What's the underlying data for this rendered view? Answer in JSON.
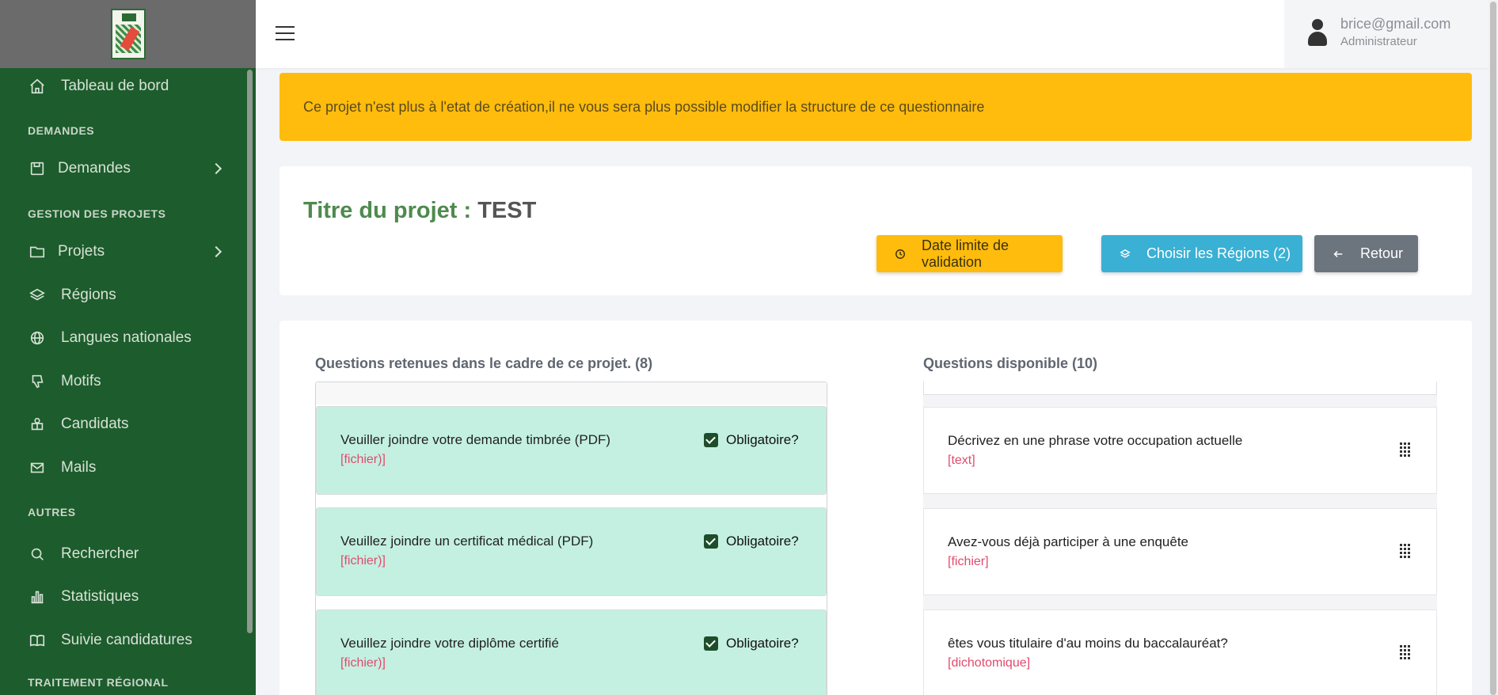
{
  "sidebar": {
    "items": [
      {
        "label": "Tableau de bord",
        "icon": "home-icon"
      },
      {
        "section": "DEMANDES"
      },
      {
        "label": "Demandes",
        "icon": "save-icon",
        "has_submenu": true
      },
      {
        "section": "GESTION DES PROJETS"
      },
      {
        "label": "Projets",
        "icon": "folder-icon",
        "has_submenu": true
      },
      {
        "label": "Régions",
        "icon": "layers-icon"
      },
      {
        "label": "Langues nationales",
        "icon": "globe-icon"
      },
      {
        "label": "Motifs",
        "icon": "thumbs-down-icon"
      },
      {
        "label": "Candidats",
        "icon": "candidate-icon"
      },
      {
        "label": "Mails",
        "icon": "mail-icon"
      },
      {
        "section": "AUTRES"
      },
      {
        "label": "Rechercher",
        "icon": "search-icon"
      },
      {
        "label": "Statistiques",
        "icon": "bar-chart-icon"
      },
      {
        "label": "Suivie candidatures",
        "icon": "book-icon"
      },
      {
        "section": "TRAITEMENT RÉGIONAL"
      }
    ]
  },
  "topbar": {
    "user_email": "brice@gmail.com",
    "user_role": "Administrateur"
  },
  "alert": {
    "message": "Ce projet n'est plus à l'etat de création,il ne vous sera plus possible modifier la structure de ce questionnaire"
  },
  "project": {
    "title_label": "Titre du projet :",
    "title_value": "TEST",
    "buttons": {
      "date_limit": "Date limite de validation",
      "regions": "Choisir les Régions (2)",
      "back": "Retour"
    }
  },
  "questions": {
    "selected_title": "Questions retenues dans le cadre de ce projet. (8)",
    "available_title": "Questions disponible (10)",
    "mandatory_label": "Obligatoire?",
    "selected": [
      {
        "text": "Veuiller joindre votre demande timbrée (PDF)",
        "type": "[fichier)]",
        "mandatory": true
      },
      {
        "text": "Veuillez joindre un certificat médical (PDF)",
        "type": "[fichier)]",
        "mandatory": true
      },
      {
        "text": "Veuillez joindre votre diplôme certifié",
        "type": "[fichier)]",
        "mandatory": true
      }
    ],
    "available": [
      {
        "text": "Décrivez en une phrase votre occupation actuelle",
        "type": "[text]"
      },
      {
        "text": "Avez-vous déjà participer à une enquête",
        "type": "[fichier]"
      },
      {
        "text": "êtes vous titulaire d'au moins du baccalauréat?",
        "type": "[dichotomique]"
      }
    ]
  },
  "colors": {
    "sidebar_bg": "#1d5c2c",
    "alert_bg": "#ffbc0d",
    "title_green": "#4e8a4e",
    "btn_info": "#3ab0d4",
    "btn_secondary": "#6c757d",
    "question_selected_bg": "#c4f0e2",
    "question_type_red": "#e14b6c"
  }
}
